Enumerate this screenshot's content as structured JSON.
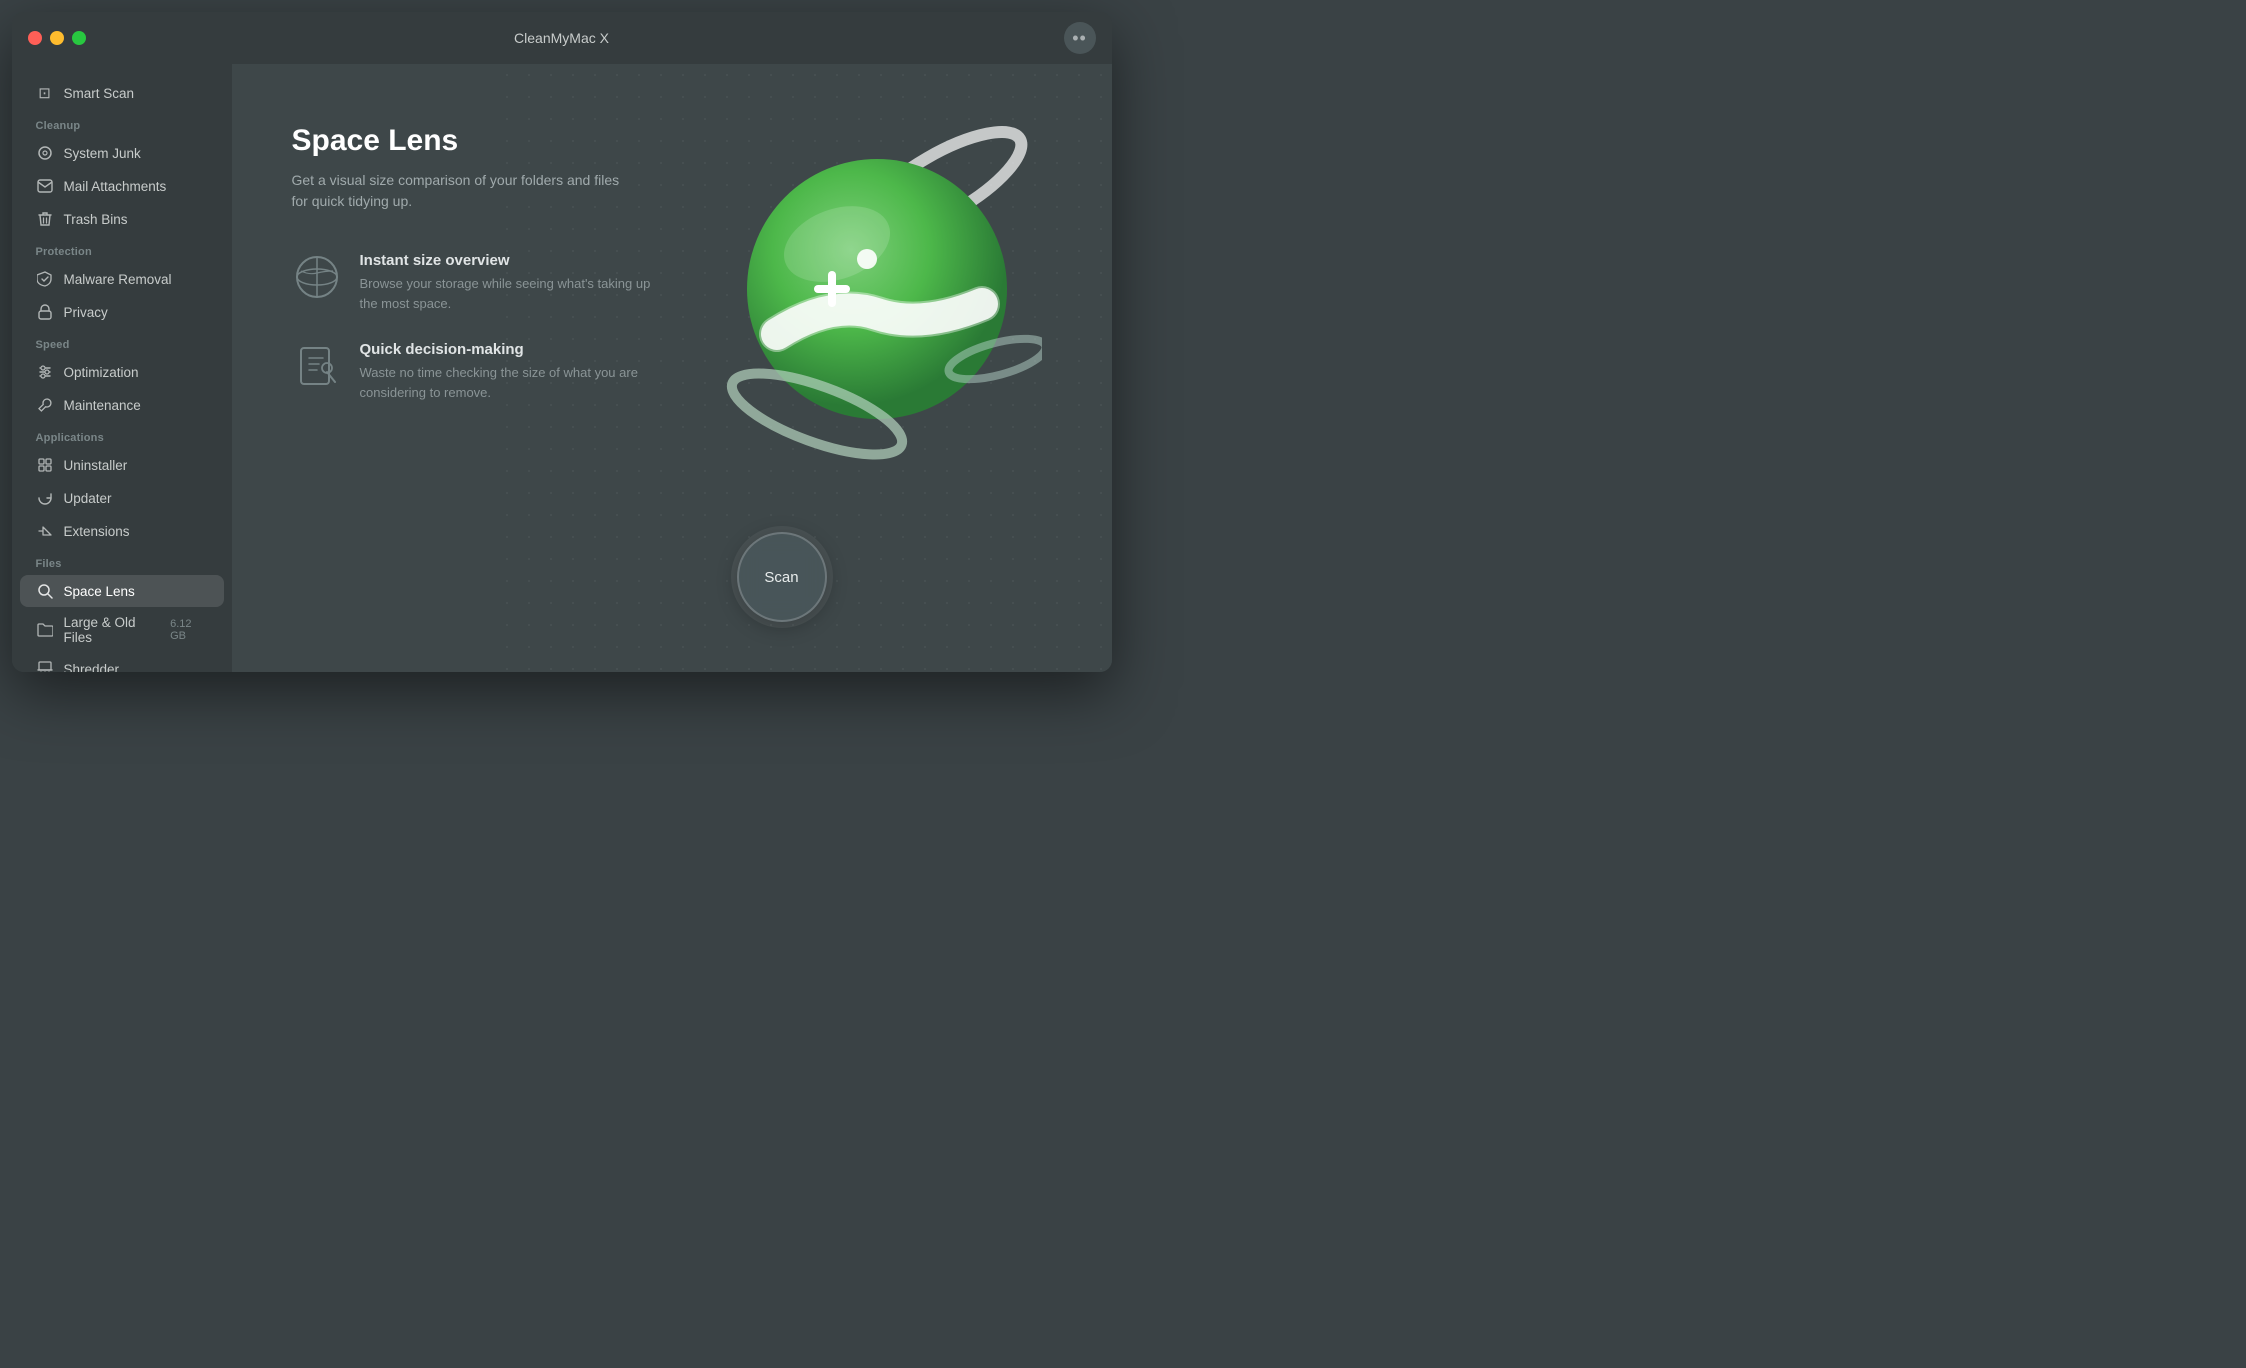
{
  "window": {
    "title": "CleanMyMac X",
    "traffic_lights": {
      "red_label": "close",
      "yellow_label": "minimize",
      "green_label": "maximize"
    }
  },
  "sidebar": {
    "smart_scan_label": "Smart Scan",
    "sections": [
      {
        "label": "Cleanup",
        "items": [
          {
            "id": "system-junk",
            "label": "System Junk",
            "icon": "⊙"
          },
          {
            "id": "mail-attachments",
            "label": "Mail Attachments",
            "icon": "✉"
          },
          {
            "id": "trash-bins",
            "label": "Trash Bins",
            "icon": "⊘"
          }
        ]
      },
      {
        "label": "Protection",
        "items": [
          {
            "id": "malware-removal",
            "label": "Malware Removal",
            "icon": "⚠"
          },
          {
            "id": "privacy",
            "label": "Privacy",
            "icon": "✋"
          }
        ]
      },
      {
        "label": "Speed",
        "items": [
          {
            "id": "optimization",
            "label": "Optimization",
            "icon": "⇅"
          },
          {
            "id": "maintenance",
            "label": "Maintenance",
            "icon": "🔧"
          }
        ]
      },
      {
        "label": "Applications",
        "items": [
          {
            "id": "uninstaller",
            "label": "Uninstaller",
            "icon": "✳"
          },
          {
            "id": "updater",
            "label": "Updater",
            "icon": "↺"
          },
          {
            "id": "extensions",
            "label": "Extensions",
            "icon": "↪"
          }
        ]
      },
      {
        "label": "Files",
        "items": [
          {
            "id": "space-lens",
            "label": "Space Lens",
            "icon": "◎",
            "active": true
          },
          {
            "id": "large-old-files",
            "label": "Large & Old Files",
            "icon": "📁",
            "badge": "6.12 GB"
          },
          {
            "id": "shredder",
            "label": "Shredder",
            "icon": "⊟"
          }
        ]
      }
    ]
  },
  "main": {
    "title": "Space Lens",
    "subtitle": "Get a visual size comparison of your folders and files for quick tidying up.",
    "features": [
      {
        "id": "instant-size-overview",
        "title": "Instant size overview",
        "description": "Browse your storage while seeing what's taking up the most space."
      },
      {
        "id": "quick-decision-making",
        "title": "Quick decision-making",
        "description": "Waste no time checking the size of what you are considering to remove."
      }
    ]
  },
  "scan_button": {
    "label": "Scan"
  }
}
